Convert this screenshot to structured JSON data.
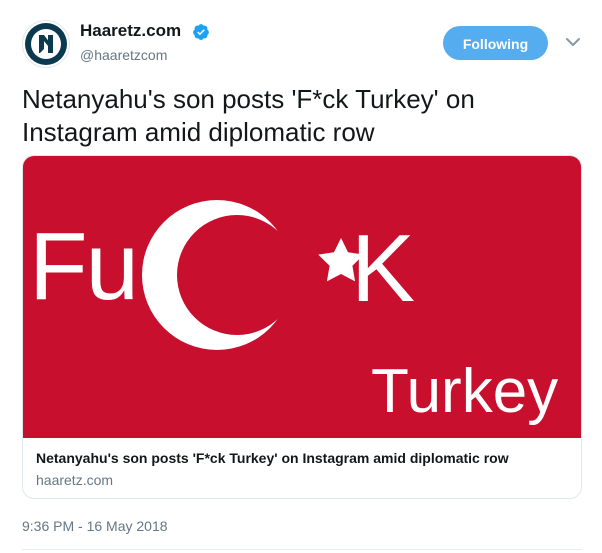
{
  "author": {
    "name": "Haaretz.com",
    "handle": "@haaretzcom",
    "avatar_icon": "haaretz-logo-icon",
    "verified_icon": "verified-badge-icon"
  },
  "follow_button": {
    "label": "Following",
    "color": "#55acee"
  },
  "menu_icon": "chevron-down-icon",
  "tweet": {
    "text": "Netanyahu's son posts 'F*ck Turkey' on Instagram amid diplomatic row",
    "timestamp": "9:36 PM - 16 May 2018"
  },
  "card": {
    "image": {
      "text_fu": "Fu",
      "text_k": "K",
      "text_turkey": "Turkey",
      "background": "#c8102e",
      "icons": [
        "crescent-icon",
        "star-icon"
      ]
    },
    "title": "Netanyahu's son posts 'F*ck Turkey' on Instagram amid diplomatic row",
    "domain": "haaretz.com"
  }
}
